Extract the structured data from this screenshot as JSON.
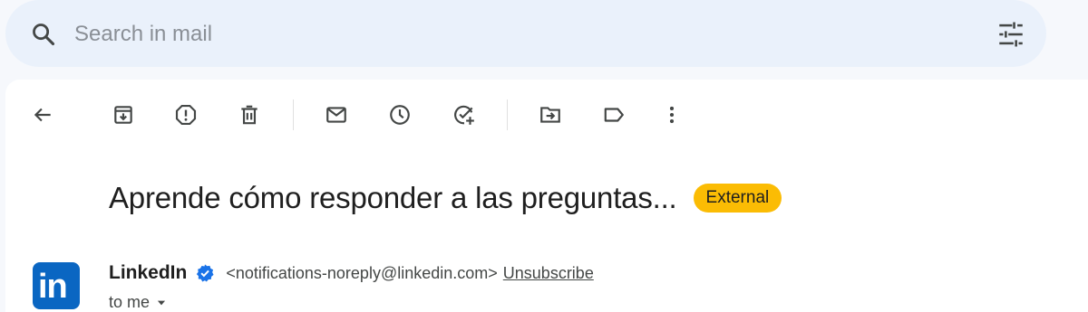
{
  "search": {
    "placeholder": "Search in mail",
    "value": "",
    "search_icon": "search-icon",
    "filter_icon": "tune-icon"
  },
  "toolbar": {
    "items": [
      {
        "name": "back",
        "icon": "arrow-back-icon"
      },
      {
        "name": "archive",
        "icon": "archive-icon"
      },
      {
        "name": "report-spam",
        "icon": "report-icon"
      },
      {
        "name": "delete",
        "icon": "trash-icon"
      },
      {
        "name": "mark-unread",
        "icon": "mail-icon"
      },
      {
        "name": "snooze",
        "icon": "clock-icon"
      },
      {
        "name": "add-to-tasks",
        "icon": "task-add-icon"
      },
      {
        "name": "move-to",
        "icon": "folder-move-icon"
      },
      {
        "name": "labels",
        "icon": "label-icon"
      },
      {
        "name": "more",
        "icon": "more-vertical-icon"
      }
    ]
  },
  "email": {
    "subject": "Aprende cómo responder a las preguntas...",
    "badge": "External",
    "badge_color": "#fbbc04",
    "sender": {
      "avatar_text": "in",
      "avatar_color": "#0a66c2",
      "name": "LinkedIn",
      "verified_icon": "verified-icon",
      "email": "<notifications-noreply@linkedin.com>",
      "unsubscribe": "Unsubscribe",
      "recipient": "to me"
    }
  }
}
